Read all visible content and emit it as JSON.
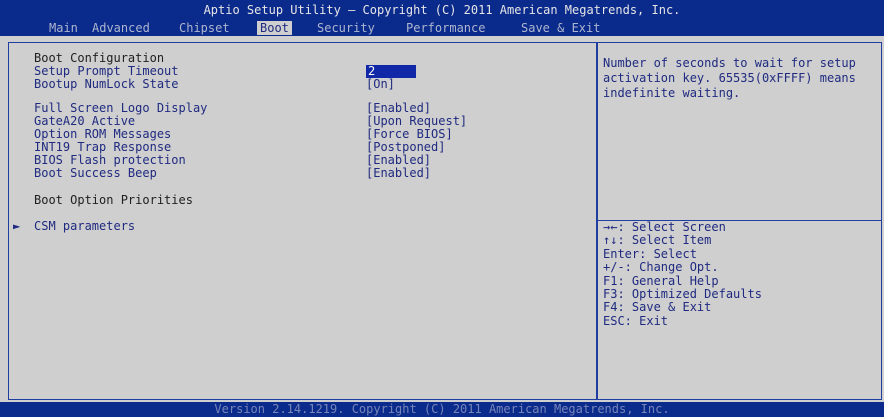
{
  "header": {
    "title": "Aptio Setup Utility – Copyright (C) 2011 American Megatrends, Inc.",
    "tabs": [
      "Main",
      "Advanced",
      "Chipset",
      "Boot",
      "Security",
      "Performance",
      "Save & Exit"
    ],
    "active_tab": "Boot"
  },
  "main": {
    "section_boot_config": "Boot Configuration",
    "items": [
      {
        "label": "Setup Prompt Timeout",
        "value": "2"
      },
      {
        "label": "Bootup NumLock State",
        "value": "[On]"
      },
      {
        "label": "Full Screen Logo Display",
        "value": "[Enabled]"
      },
      {
        "label": "GateA20 Active",
        "value": "[Upon Request]"
      },
      {
        "label": "Option ROM Messages",
        "value": "[Force BIOS]"
      },
      {
        "label": "INT19 Trap Response",
        "value": "[Postponed]"
      },
      {
        "label": "BIOS Flash protection",
        "value": "[Enabled]"
      },
      {
        "label": "Boot Success Beep",
        "value": "[Enabled]"
      }
    ],
    "section_boot_priorities": "Boot Option Priorities",
    "submenu_label": "CSM parameters",
    "submenu_arrow": "►"
  },
  "help": {
    "text": "Number of seconds to wait for setup activation key. 65535(0xFFFF) means indefinite waiting."
  },
  "keys": [
    "→←: Select Screen",
    "↑↓: Select Item",
    "Enter: Select",
    "+/-: Change Opt.",
    "F1: General Help",
    "F3: Optimized Defaults",
    "F4: Save & Exit",
    "ESC: Exit"
  ],
  "footer": {
    "text": "Version 2.14.1219. Copyright (C) 2011 American Megatrends, Inc."
  },
  "colors": {
    "header_bg": "#0a2a8c",
    "body_bg": "#cfcfcf",
    "text_blue": "#1f2a80",
    "selection_bg": "#1027a8"
  }
}
